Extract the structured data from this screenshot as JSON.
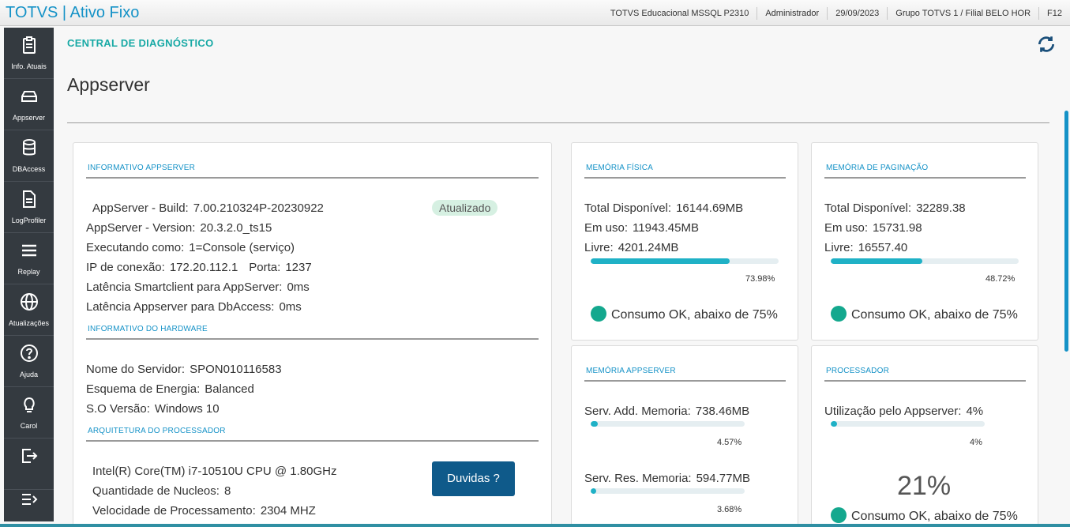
{
  "header": {
    "app_title": "TOTVS | Ativo Fixo",
    "environment": "TOTVS Educacional MSSQL P2310",
    "user": "Administrador",
    "date": "29/09/2023",
    "company": "Grupo TOTVS 1 / Filial BELO HOR",
    "shortcut": "F12"
  },
  "sidebar": {
    "items": [
      {
        "label": "Info. Atuais",
        "icon": "clipboard-icon"
      },
      {
        "label": "Appserver",
        "icon": "server-icon"
      },
      {
        "label": "DBAccess",
        "icon": "database-icon"
      },
      {
        "label": "LogProfiler",
        "icon": "document-icon"
      },
      {
        "label": "Replay",
        "icon": "replay-icon"
      },
      {
        "label": "Atualizações",
        "icon": "globe-icon"
      },
      {
        "label": "Ajuda",
        "icon": "help-icon"
      },
      {
        "label": "Carol",
        "icon": "lightbulb-icon"
      },
      {
        "label": "",
        "icon": "exit-icon"
      },
      {
        "label": "",
        "icon": "collapse-icon"
      }
    ]
  },
  "breadcrumb": "CENTRAL DE DIAGNÓSTICO",
  "page_title": "Appserver",
  "appserver_info": {
    "title": "INFORMATIVO APPSERVER",
    "build_label": "AppServer - Build:",
    "build_value": "7.00.210324P-20230922",
    "build_status": "Atualizado",
    "version_label": "AppServer - Version:",
    "version_value": "20.3.2.0_ts15",
    "running_label": "Executando como:",
    "running_value": "1=Console (serviço)",
    "ip_label": "IP de conexão:",
    "ip_value": "172.20.112.1",
    "port_label": "Porta:",
    "port_value": "1237",
    "latency_sc_label": "Latência Smartclient para AppServer:",
    "latency_sc_value": "0ms",
    "latency_db_label": "Latência Appserver para DbAccess:",
    "latency_db_value": "0ms"
  },
  "hardware_info": {
    "title": "INFORMATIVO DO HARDWARE",
    "server_label": "Nome do Servidor:",
    "server_value": "SPON010116583",
    "energy_label": "Esquema de Energia:",
    "energy_value": "Balanced",
    "os_label": "S.O Versão:",
    "os_value": "Windows 10"
  },
  "processor_arch": {
    "title": "ARQUITETURA DO PROCESSADOR",
    "cpu_name": "Intel(R) Core(TM) i7-10510U CPU @ 1.80GHz",
    "cores_label": "Quantidade de Nucleos:",
    "cores_value": "8",
    "speed_label": "Velocidade de Processamento:",
    "speed_value": "2304 MHZ",
    "help_button": "Duvidas ?"
  },
  "physical_memory": {
    "title": "MEMÓRIA FÍSICA",
    "total_label": "Total Disponível:",
    "total_value": "16144.69MB",
    "used_label": "Em uso:",
    "used_value": "11943.45MB",
    "free_label": "Livre:",
    "free_value": "4201.24MB",
    "usage_percent": 73.98,
    "usage_text": "73.98%",
    "status": "Consumo OK, abaixo de 75%",
    "status_color": "#14a88e"
  },
  "paging_memory": {
    "title": "MEMÓRIA DE PAGINAÇÃO",
    "total_label": "Total Disponível:",
    "total_value": "32289.38",
    "used_label": "Em uso:",
    "used_value": "15731.98",
    "free_label": "Livre:",
    "free_value": "16557.40",
    "usage_percent": 48.72,
    "usage_text": "48.72%",
    "status": "Consumo OK, abaixo de 75%",
    "status_color": "#14a88e"
  },
  "appserver_memory": {
    "title": "MEMÓRIA APPSERVER",
    "add_label": "Serv. Add. Memoria:",
    "add_value": "738.46MB",
    "add_percent": 4.57,
    "add_text": "4.57%",
    "res_label": "Serv. Res. Memoria:",
    "res_value": "594.77MB",
    "res_percent": 3.68,
    "res_text": "3.68%"
  },
  "processor": {
    "title": "PROCESSADOR",
    "usage_label": "Utilização pelo Appserver:",
    "usage_value": "4%",
    "usage_percent": 4,
    "usage_text": "4%",
    "total_usage": "21%",
    "status": "Consumo OK, abaixo de 75%",
    "status_color": "#14a88e"
  },
  "colors": {
    "accent": "#1592c7",
    "teal": "#18a9a5",
    "sidebar": "#343a40",
    "bar_fill": "#1fb1c6",
    "button": "#0f5a8a"
  }
}
